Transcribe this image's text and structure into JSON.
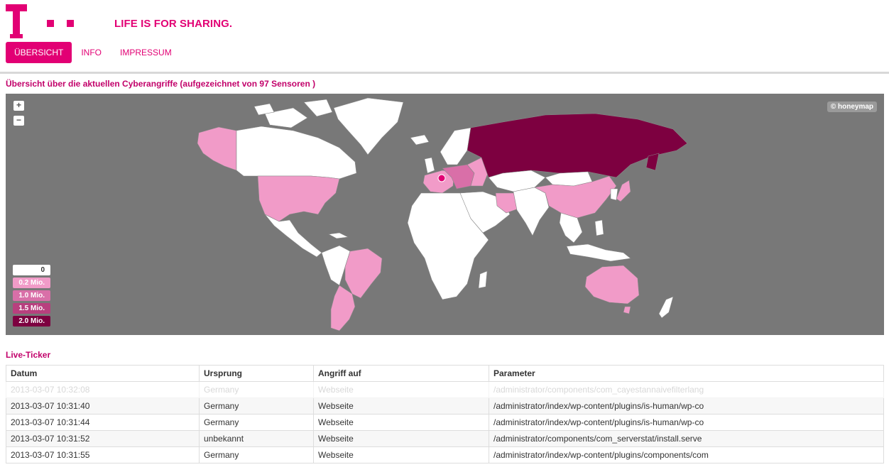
{
  "brand": {
    "slogan": "LIFE IS FOR SHARING.",
    "color": "#e20074"
  },
  "nav": {
    "items": [
      "ÜBERSICHT",
      "INFO",
      "IMPRESSUM"
    ],
    "active": "ÜBERSICHT"
  },
  "map_section": {
    "title": "Übersicht über die aktuellen Cyberangriffe (aufgezeichnet von 97 Sensoren )",
    "zoom_in": "+",
    "zoom_out": "−",
    "attribution": "© honeymap",
    "legend": [
      {
        "label": "0",
        "color": "#ffffff"
      },
      {
        "label": "0.2 Mio.",
        "color": "#f19bc8"
      },
      {
        "label": "1.0 Mio.",
        "color": "#d96fa8"
      },
      {
        "label": "1.5 Mio.",
        "color": "#b8407e"
      },
      {
        "label": "2.0 Mio.",
        "color": "#7d0040"
      }
    ]
  },
  "ticker": {
    "title": "Live-Ticker",
    "columns": [
      "Datum",
      "Ursprung",
      "Angriff auf",
      "Parameter"
    ],
    "rows": [
      [
        "2013-03-07 10:32:08",
        "Germany",
        "Webseite",
        "/administrator/components/com_cayestannaivefilterlang"
      ],
      [
        "2013-03-07 10:31:40",
        "Germany",
        "Webseite",
        "/administrator/index/wp-content/plugins/is-human/wp-co"
      ],
      [
        "2013-03-07 10:31:44",
        "Germany",
        "Webseite",
        "/administrator/index/wp-content/plugins/is-human/wp-co"
      ],
      [
        "2013-03-07 10:31:52",
        "unbekannt",
        "Webseite",
        "/administrator/components/com_serverstat/install.serve"
      ],
      [
        "2013-03-07 10:31:55",
        "Germany",
        "Webseite",
        "/administrator/index/wp-content/plugins/components/com"
      ]
    ]
  }
}
